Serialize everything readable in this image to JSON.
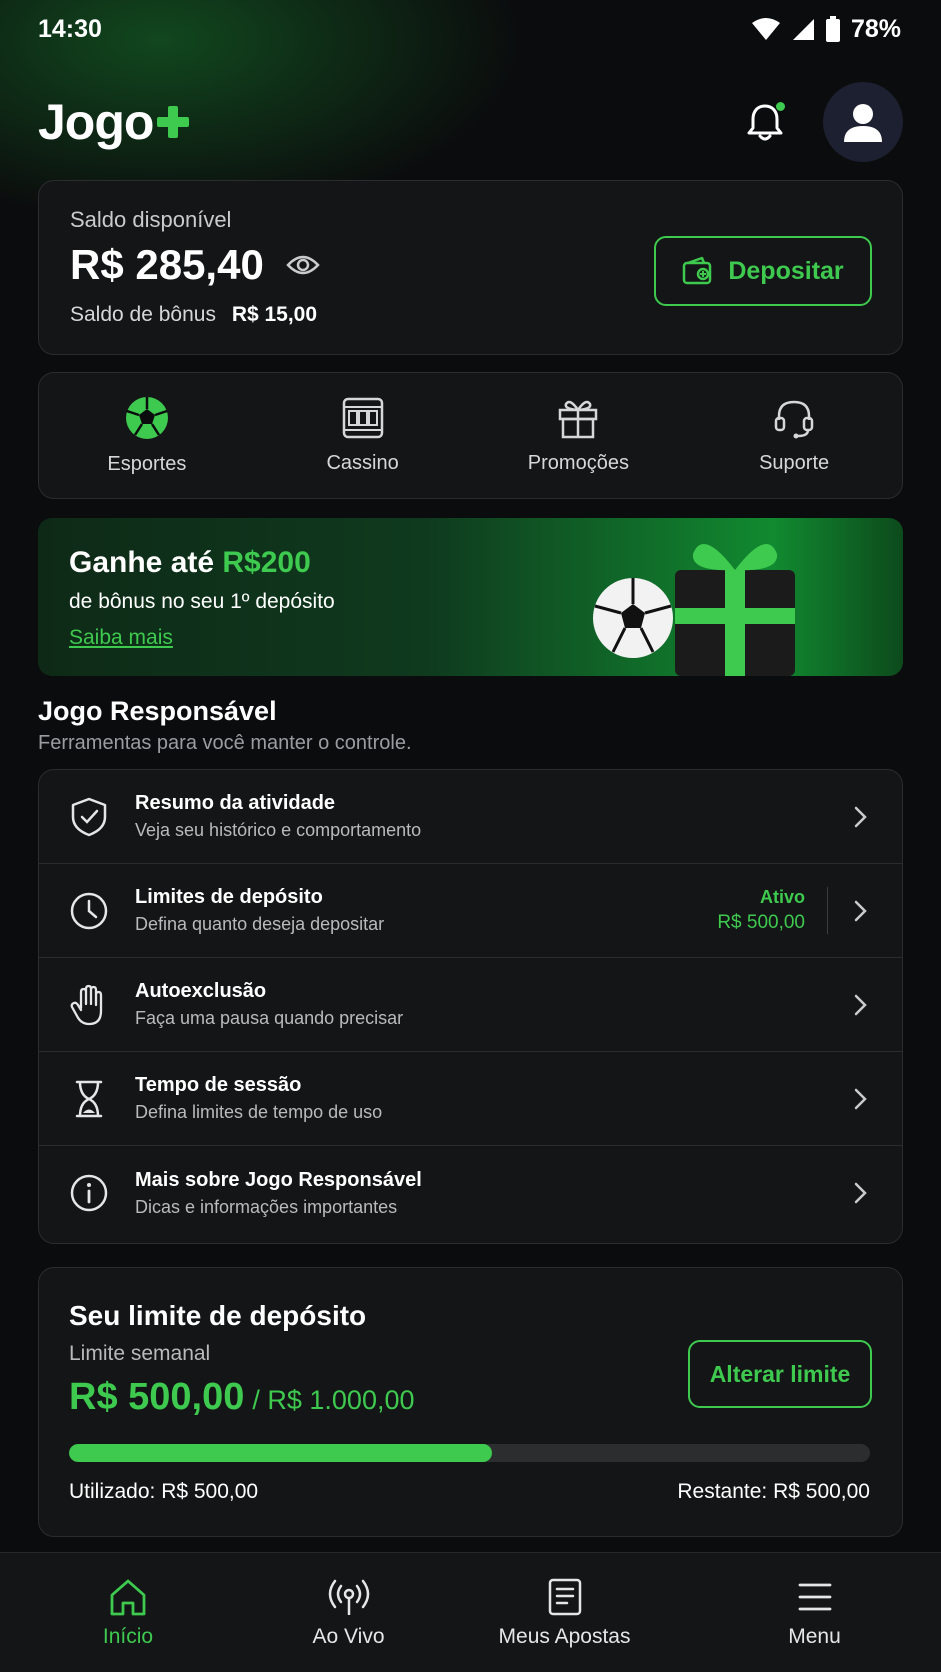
{
  "status_bar": {
    "time": "14:30",
    "battery": "78%"
  },
  "header": {
    "logo_text": "Jogo",
    "logo_plus": "+",
    "notification_dot": true
  },
  "balance": {
    "label": "Saldo disponível",
    "amount": "R$ 285,40",
    "bonus_label": "Saldo de bônus",
    "bonus_amount": "R$ 15,00",
    "deposit_label": "Depositar"
  },
  "shortcuts": [
    {
      "label": "Esportes",
      "icon": "soccer-ball-icon"
    },
    {
      "label": "Cassino",
      "icon": "slot-machine-icon"
    },
    {
      "label": "Promoções",
      "icon": "gift-icon"
    },
    {
      "label": "Suporte",
      "icon": "headset-icon"
    }
  ],
  "promo": {
    "title_prefix": "Ganhe até ",
    "title_highlight": "R$200",
    "subtitle": "de bônus no seu 1º depósito",
    "link": "Saiba mais"
  },
  "responsible": {
    "title": "Jogo Responsável",
    "subtitle": "Ferramentas para você manter o controle.",
    "items": [
      {
        "title": "Resumo da atividade",
        "desc": "Veja seu histórico e comportamento",
        "icon": "shield-check-icon"
      },
      {
        "title": "Limites de depósito",
        "desc": "Defina quanto deseja depositar",
        "icon": "clock-icon",
        "status_label": "Ativo",
        "status_value": "R$ 500,00"
      },
      {
        "title": "Autoexclusão",
        "desc": "Faça uma pausa quando precisar",
        "icon": "hand-icon"
      },
      {
        "title": "Tempo de sessão",
        "desc": "Defina limites de tempo de uso",
        "icon": "hourglass-icon"
      },
      {
        "title": "Mais sobre Jogo Responsável",
        "desc": "Dicas e informações importantes",
        "icon": "info-icon"
      }
    ]
  },
  "deposit_limit": {
    "title": "Seu limite de depósito",
    "period": "Limite semanal",
    "used": "R$ 500,00",
    "total": "/ R$ 1.000,00",
    "button": "Alterar limite",
    "progress_fraction": 0.528,
    "used_label": "Utilizado: R$ 500,00",
    "remaining_label": "Restante: R$ 500,00"
  },
  "bottom_nav": [
    {
      "label": "Início",
      "icon": "home-icon",
      "active": true
    },
    {
      "label": "Ao Vivo",
      "icon": "live-broadcast-icon",
      "active": false
    },
    {
      "label": "Meus Apostas",
      "icon": "betslip-icon",
      "active": false
    },
    {
      "label": "Menu",
      "icon": "hamburger-menu-icon",
      "active": false
    }
  ],
  "colors": {
    "accent": "#3ec94f",
    "background": "#0b0c0d",
    "card": "#141516"
  }
}
